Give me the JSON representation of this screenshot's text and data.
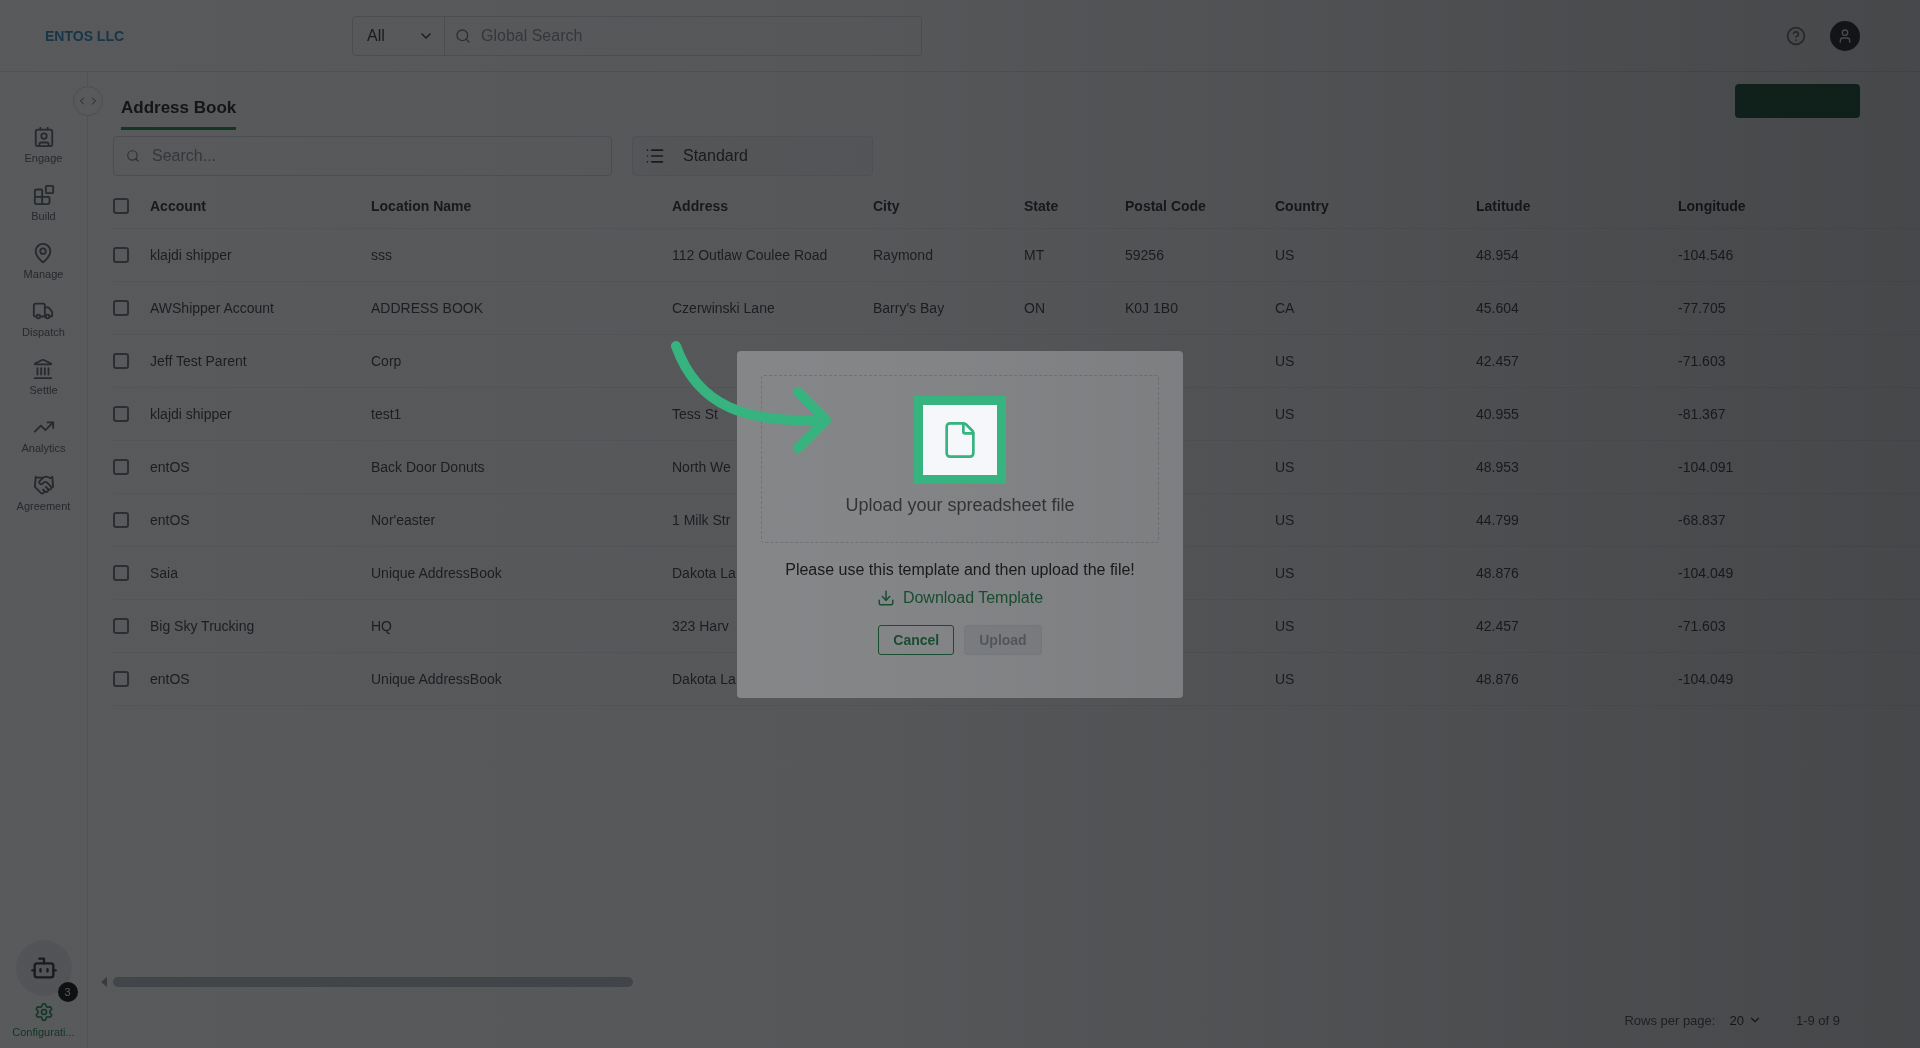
{
  "header": {
    "logo": "ENTOS LLC",
    "search_scope": "All",
    "search": {
      "placeholder": "Global Search"
    }
  },
  "sidebar": {
    "items": [
      {
        "label": "Engage",
        "selected": false
      },
      {
        "label": "Build",
        "selected": false
      },
      {
        "label": "Manage",
        "selected": false
      },
      {
        "label": "Dispatch",
        "selected": false
      },
      {
        "label": "Settle",
        "selected": false
      },
      {
        "label": "Analytics",
        "selected": false
      },
      {
        "label": "Agreement",
        "selected": false
      }
    ],
    "assistant_badge": "3",
    "bottom_item": {
      "label": "Configurati...",
      "selected": true
    }
  },
  "tabs": [
    {
      "label": "Address Book",
      "selected": true
    }
  ],
  "toolbar": {
    "search": {
      "placeholder": "Search..."
    },
    "view": "Standard"
  },
  "table": {
    "header_checked": false,
    "columns": [
      "Account",
      "Location Name",
      "Address",
      "City",
      "State",
      "Postal Code",
      "Country",
      "Latitude",
      "Longitude"
    ],
    "rows": [
      {
        "checked": false,
        "cells": {
          "account": "klajdi shipper",
          "location": "sss",
          "address": "112 Outlaw Coulee Road",
          "city": "Raymond",
          "state": "MT",
          "postal_code": "59256",
          "country": "US",
          "latitude": "48.954",
          "longitude": "-104.546"
        }
      },
      {
        "checked": false,
        "cells": {
          "account": "AWShipper Account",
          "location": "ADDRESS BOOK",
          "address": "Czerwinski Lane",
          "city": "Barry's Bay",
          "state": "ON",
          "postal_code": "K0J 1B0",
          "country": "CA",
          "latitude": "45.604",
          "longitude": "-77.705"
        }
      },
      {
        "checked": false,
        "cells": {
          "account": "Jeff Test Parent",
          "location": "Corp",
          "country": "US",
          "latitude": "42.457",
          "longitude": "-71.603"
        }
      },
      {
        "checked": false,
        "cells": {
          "account": "klajdi shipper",
          "location": "test1",
          "address": "Tess St",
          "country": "US",
          "latitude": "40.955",
          "longitude": "-81.367"
        }
      },
      {
        "checked": false,
        "cells": {
          "account": "entOS",
          "location": "Back Door Donuts",
          "address": "North We",
          "country": "US",
          "latitude": "48.953",
          "longitude": "-104.091"
        }
      },
      {
        "checked": false,
        "cells": {
          "account": "entOS",
          "location": "Nor'easter",
          "address": "1 Milk Str",
          "country": "US",
          "latitude": "44.799",
          "longitude": "-68.837"
        }
      },
      {
        "checked": false,
        "cells": {
          "account": "Saia",
          "location": "Unique AddressBook",
          "address": "Dakota La",
          "country": "US",
          "latitude": "48.876",
          "longitude": "-104.049"
        }
      },
      {
        "checked": false,
        "cells": {
          "account": "Big Sky Trucking",
          "location": "HQ",
          "address": "323 Harv",
          "country": "US",
          "latitude": "42.457",
          "longitude": "-71.603"
        }
      },
      {
        "checked": false,
        "cells": {
          "account": "entOS",
          "location": "Unique AddressBook",
          "address": "Dakota La",
          "country": "US",
          "latitude": "48.876",
          "longitude": "-104.049"
        }
      }
    ]
  },
  "pagination": {
    "label": "Rows per page:",
    "rows_per_page": "20",
    "range": "1-9 of 9"
  },
  "modal": {
    "dropzone_text": "Upload your spreadsheet file",
    "instruction": "Please use this template and then upload the file!",
    "link": "Download Template",
    "buttons": [
      {
        "label": "Cancel",
        "kind": "outline",
        "disabled": false
      },
      {
        "label": "Upload",
        "kind": "solid",
        "disabled": true
      }
    ]
  }
}
